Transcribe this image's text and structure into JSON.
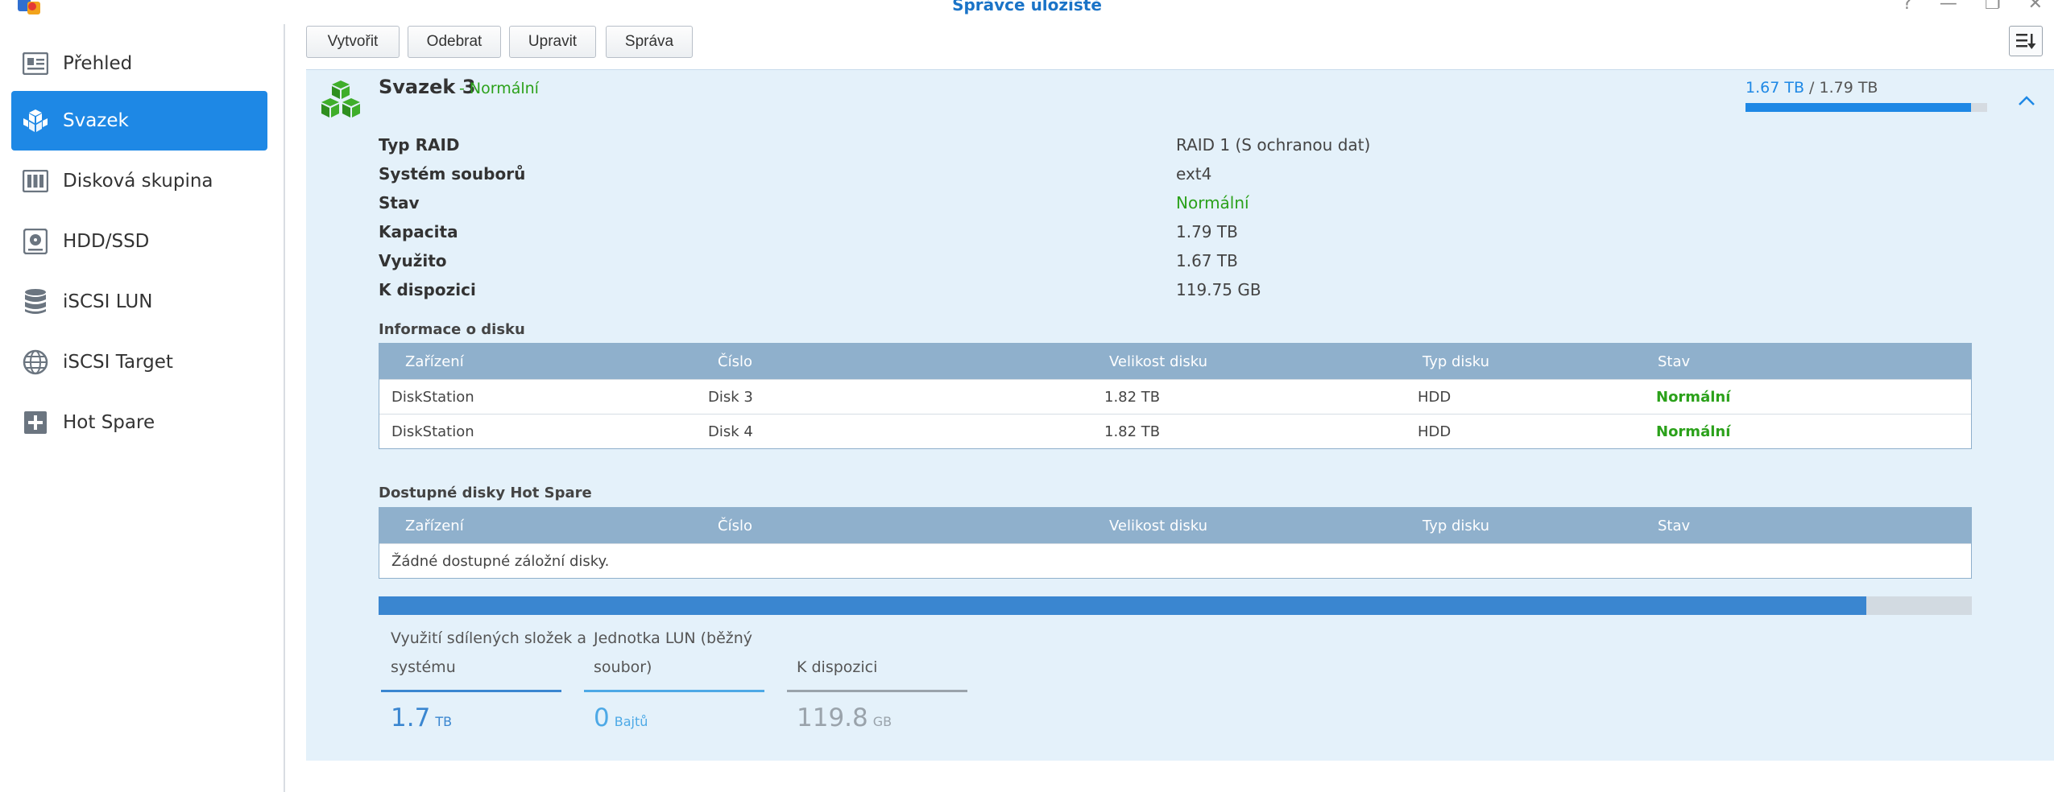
{
  "window": {
    "title": "Správce úložiště"
  },
  "sidebar": {
    "items": [
      {
        "label": "Přehled",
        "icon": "overview-icon"
      },
      {
        "label": "Svazek",
        "icon": "volume-icon"
      },
      {
        "label": "Disková skupina",
        "icon": "disk-group-icon"
      },
      {
        "label": "HDD/SSD",
        "icon": "hdd-icon"
      },
      {
        "label": "iSCSI LUN",
        "icon": "database-icon"
      },
      {
        "label": "iSCSI Target",
        "icon": "globe-icon"
      },
      {
        "label": "Hot Spare",
        "icon": "plus-box-icon"
      }
    ],
    "active": "Svazek"
  },
  "toolbar": {
    "create": "Vytvořit",
    "remove": "Odebrat",
    "edit": "Upravit",
    "manage": "Správa"
  },
  "volume": {
    "title": "Svazek 3",
    "status": "- Normální",
    "used": "1.67 TB",
    "separator": " / ",
    "total": "1.79 TB",
    "usage_fraction": 0.933,
    "properties": [
      {
        "label": "Typ RAID",
        "value": "RAID 1 (S ochranou dat)"
      },
      {
        "label": "Systém souborů",
        "value": "ext4"
      },
      {
        "label": "Stav",
        "value": "Normální"
      },
      {
        "label": "Kapacita",
        "value": "1.79 TB"
      },
      {
        "label": "Využito",
        "value": "1.67 TB"
      },
      {
        "label": "K dispozici",
        "value": "119.75 GB"
      }
    ]
  },
  "disk_info": {
    "title": "Informace o disku",
    "headers": [
      "Zařízení",
      "Číslo",
      "Velikost disku",
      "Typ disku",
      "Stav"
    ],
    "rows": [
      [
        "DiskStation",
        "Disk 3",
        "1.82 TB",
        "HDD",
        "Normální"
      ],
      [
        "DiskStation",
        "Disk 4",
        "1.82 TB",
        "HDD",
        "Normální"
      ]
    ]
  },
  "hot_spare": {
    "title": "Dostupné disky Hot Spare",
    "headers": [
      "Zařízení",
      "Číslo",
      "Velikost disku",
      "Typ disku",
      "Stav"
    ],
    "empty": "Žádné dostupné záložní disky."
  },
  "breakdown": {
    "fill_fraction": 0.934,
    "items": [
      {
        "label_line1": "Využití sdílených složek a",
        "label_line2": "systému",
        "value": "1.7",
        "unit": "TB",
        "color": "#3a86d0"
      },
      {
        "label_line1": "Jednotka LUN (běžný",
        "label_line2": "soubor)",
        "value": "0",
        "unit": "Bajtů",
        "color": "#4da9e6"
      },
      {
        "label_line1": "",
        "label_line2": "K dispozici",
        "value": "119.8",
        "unit": "GB",
        "color": "#9aa3ab"
      }
    ]
  },
  "colors": {
    "accent": "#1e88e5",
    "ok": "#2ba11a",
    "table_header": "#8fb0cc",
    "panel": "#e4f1fa"
  }
}
